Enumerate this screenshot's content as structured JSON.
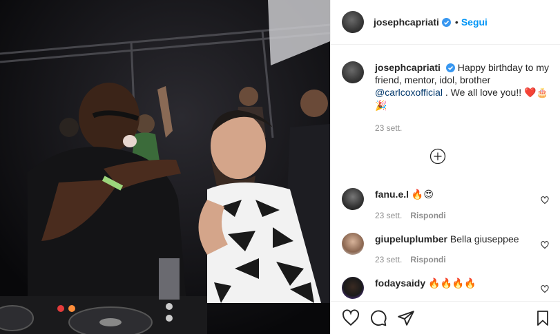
{
  "header": {
    "username": "josephcapriati",
    "separator": "•",
    "follow_label": "Segui"
  },
  "caption": {
    "username": "josephcapriati",
    "text_before": "Happy birthday to my friend, mentor, idol, brother",
    "mention": "@carlcoxofficial",
    "text_after": ". We all love you!!",
    "emojis": "❤️🎂🎉",
    "timestamp": "23 sett."
  },
  "comments": [
    {
      "username": "fanu.e.l",
      "text": "🔥😍",
      "time": "23 sett.",
      "reply_label": "Rispondi"
    },
    {
      "username": "giupeluplumber",
      "text": "Bella giuseppee",
      "time": "23 sett.",
      "reply_label": "Rispondi"
    },
    {
      "username": "fodaysaidy",
      "text": "🔥🔥🔥🔥",
      "time": "",
      "reply_label": ""
    }
  ],
  "colors": {
    "accent": "#0095f6",
    "mention": "#00376b",
    "muted": "#8e8e8e",
    "verified": "#3897f0"
  },
  "icons": [
    "verified-icon",
    "load-more-icon",
    "heart-icon",
    "comment-icon",
    "share-icon",
    "bookmark-icon"
  ]
}
